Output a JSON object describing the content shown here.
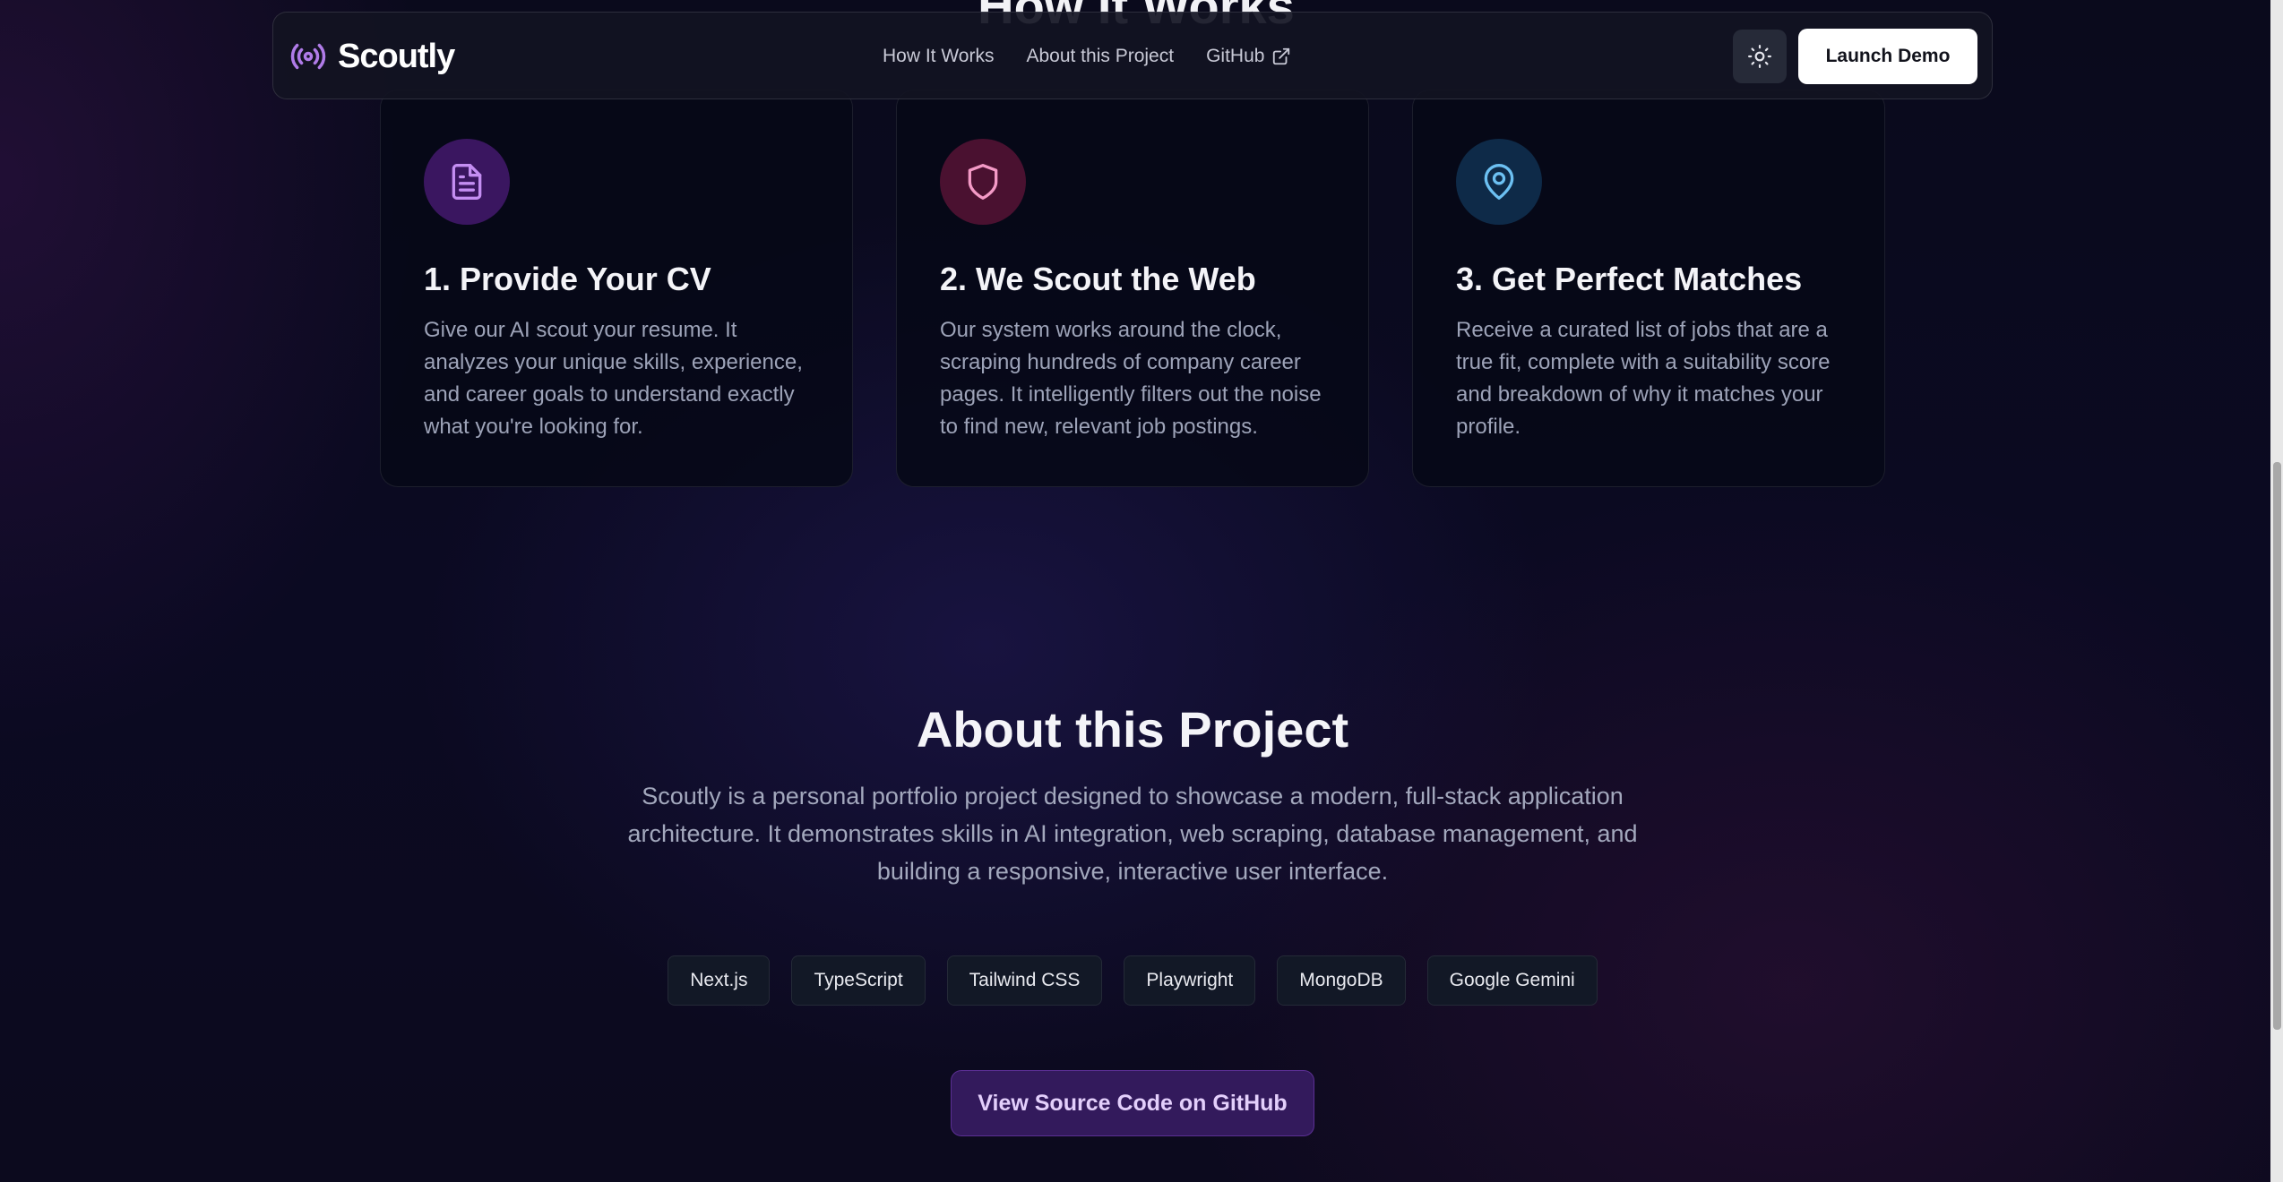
{
  "how_it_works": {
    "title": "How It Works"
  },
  "nav": {
    "brand": "Scoutly",
    "links": [
      "How It Works",
      "About this Project",
      "GitHub"
    ],
    "launch_label": "Launch Demo"
  },
  "steps": [
    {
      "title": "1. Provide Your CV",
      "text": "Give our AI scout your resume. It analyzes your unique skills, experience, and career goals to understand exactly what you're looking for.",
      "icon": "document-icon",
      "color": "#b07be8"
    },
    {
      "title": "2. We Scout the Web",
      "text": "Our system works around the clock, scraping hundreds of company career pages. It intelligently filters out the noise to find new, relevant job postings.",
      "icon": "shield-icon",
      "color": "#f28ac0"
    },
    {
      "title": "3. Get Perfect Matches",
      "text": "Receive a curated list of jobs that are a true fit, complete with a suitability score and breakdown of why it matches your profile.",
      "icon": "map-pin-icon",
      "color": "#69b9f0"
    }
  ],
  "about": {
    "title": "About this Project",
    "text": "Scoutly is a personal portfolio project designed to showcase a modern, full-stack application architecture. It demonstrates skills in AI integration, web scraping, database management, and building a responsive, interactive user interface.",
    "tags": [
      "Next.js",
      "TypeScript",
      "Tailwind CSS",
      "Playwright",
      "MongoDB",
      "Google Gemini"
    ],
    "github_button": "View Source Code on GitHub"
  },
  "colors": {
    "accent": "#a66ce8",
    "background": "#0a0a1c"
  }
}
